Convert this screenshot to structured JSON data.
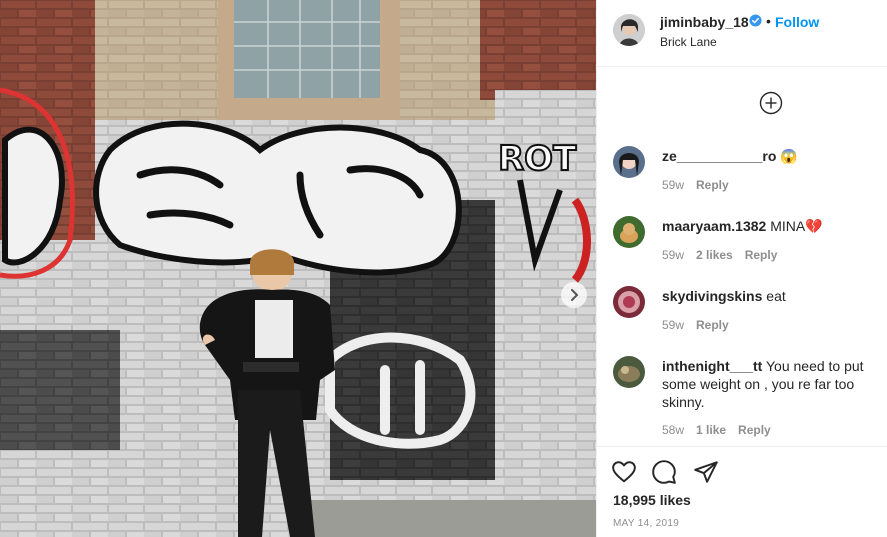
{
  "post": {
    "username": "jiminbaby_18",
    "verified": true,
    "separator": "•",
    "follow_label": "Follow",
    "location": "Brick Lane",
    "likes": "18,995 likes",
    "date": "MAY 14, 2019",
    "photo_graffiti_text": "ROT"
  },
  "comments": [
    {
      "username": "ze___________ro",
      "text": "😱",
      "age": "59w",
      "likes": "",
      "reply": "Reply"
    },
    {
      "username": "maaryaam.1382",
      "text": "MINA💔",
      "age": "59w",
      "likes": "2 likes",
      "reply": "Reply"
    },
    {
      "username": "skydivingskins",
      "text": "eat",
      "age": "59w",
      "likes": "",
      "reply": "Reply"
    },
    {
      "username": "inthenight___tt",
      "text": "You need to put some weight on , you re far too skinny.",
      "age": "58w",
      "likes": "1 like",
      "reply": "Reply"
    }
  ],
  "icons": {
    "verified": "verified-badge-icon",
    "load_more": "plus-circle-icon",
    "like": "heart-icon",
    "comment": "comment-bubble-icon",
    "share": "paper-plane-icon",
    "carousel": "chevron-right-icon"
  },
  "colors": {
    "link_blue": "#0095f6",
    "verified_blue": "#3897f0",
    "meta_gray": "#8e8e8e",
    "divider": "#efefef"
  }
}
